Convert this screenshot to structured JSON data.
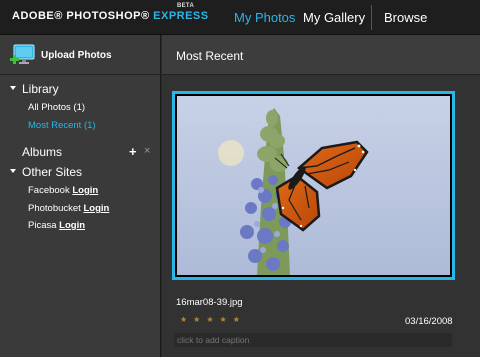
{
  "app": {
    "logo_main": "ADOBE® PHOTOSHOP®",
    "logo_express": "EXPRESS",
    "logo_beta": "BETA"
  },
  "nav": {
    "my_photos": "My Photos",
    "my_gallery": "My Gallery",
    "browse": "Browse"
  },
  "sidebar": {
    "upload_label": "Upload Photos",
    "library_header": "Library",
    "library_items": [
      {
        "label": "All Photos (1)"
      },
      {
        "label": "Most Recent (1)"
      }
    ],
    "albums_header": "Albums",
    "albums_add": "+",
    "albums_remove": "×",
    "other_sites_header": "Other Sites",
    "other_sites": [
      {
        "name": "Facebook",
        "action": "Login"
      },
      {
        "name": "Photobucket",
        "action": "Login"
      },
      {
        "name": "Picasa",
        "action": "Login"
      }
    ]
  },
  "main": {
    "title": "Most Recent",
    "photo": {
      "filename": "16mar08-39.jpg",
      "rating_stars": "★★★★★",
      "date": "03/16/2008",
      "caption_placeholder": "click to add caption"
    }
  },
  "colors": {
    "accent": "#29b6e8",
    "star": "#b08a3a"
  }
}
